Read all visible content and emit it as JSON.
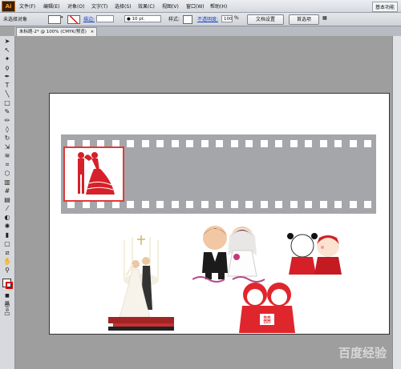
{
  "app": {
    "logo": "Ai"
  },
  "menu": [
    {
      "label": "文件(F)"
    },
    {
      "label": "编辑(E)"
    },
    {
      "label": "对象(O)"
    },
    {
      "label": "文字(T)"
    },
    {
      "label": "选择(S)"
    },
    {
      "label": "效果(C)"
    },
    {
      "label": "视图(V)"
    },
    {
      "label": "窗口(W)"
    },
    {
      "label": "帮助(H)"
    }
  ],
  "workspace": {
    "label": "基本功能"
  },
  "control_bar": {
    "selection_status": "未选择对象",
    "stroke_label": "描边:",
    "brush_value": "10 pt.",
    "style_label": "样式:",
    "opacity_label": "不透明度:",
    "opacity_value": "100",
    "opacity_unit": "%",
    "doc_setup": "文档设置",
    "preferences": "首选项",
    "fill_color": "#ffffff"
  },
  "document": {
    "tab_label": "未标题-2* @ 100% (CMYK/预览)",
    "close": "×"
  },
  "filmstrip": {
    "color": "#a4a6a9",
    "highlight_color": "#e23a3a"
  },
  "watermark": {
    "text": "百度经验"
  }
}
